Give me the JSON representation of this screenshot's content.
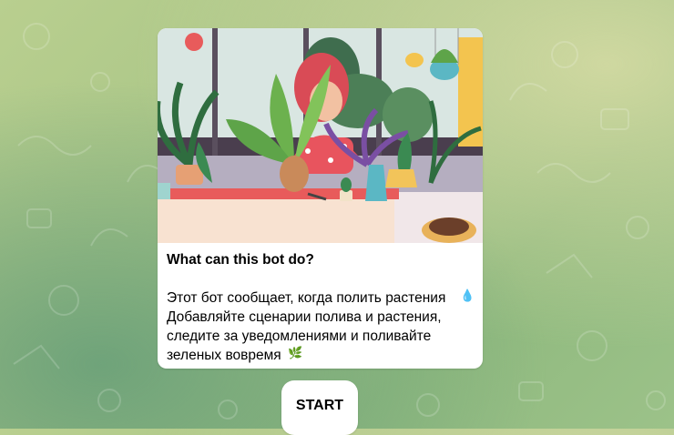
{
  "bot_info": {
    "title": "What can this bot do?",
    "description": "Этот бот сообщает, когда полить растения\nДобавляйте сценарии полива и растения,\nследите за уведомлениями и поливайте\nзеленых вовремя",
    "emoji_watering": "💧",
    "emoji_leaf": "🌿",
    "illustration": "woman-with-houseplants-illustration"
  },
  "start_button": {
    "label": "START"
  },
  "colors": {
    "background": "#a7c486",
    "card": "#ffffff",
    "text": "#000000"
  }
}
